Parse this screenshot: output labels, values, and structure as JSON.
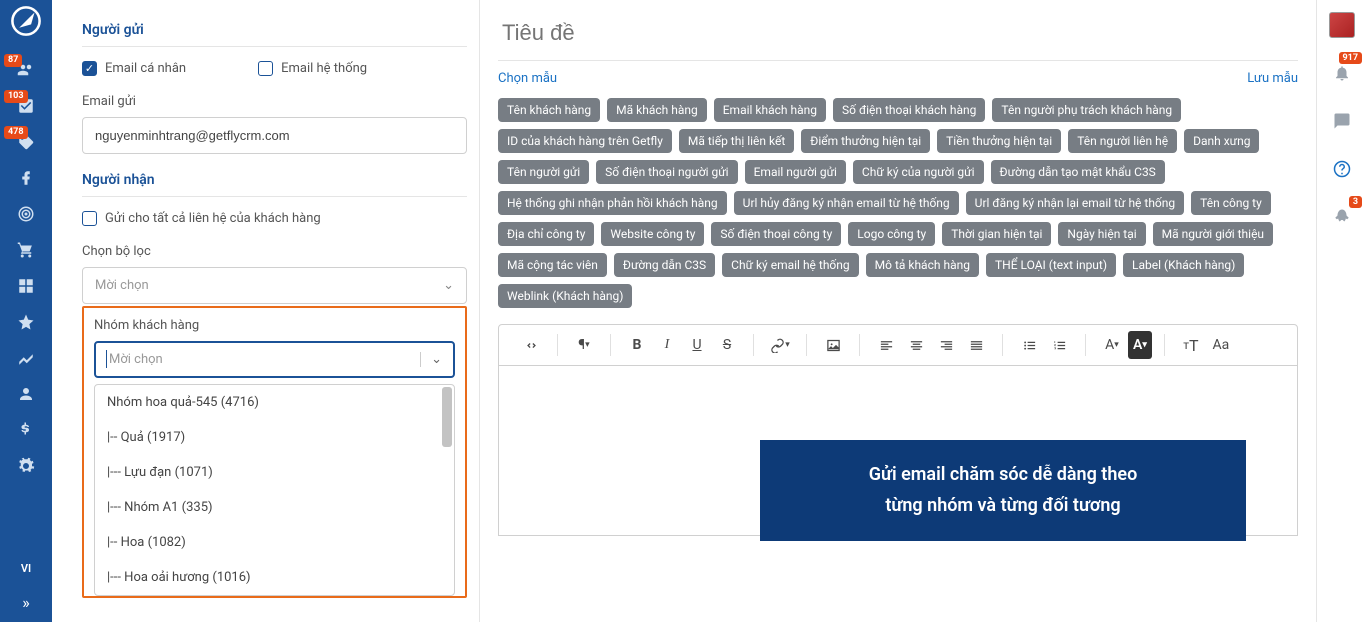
{
  "sidebar_left": {
    "badges": [
      "87",
      "103",
      "478"
    ],
    "vi": "VI",
    "expand": "»"
  },
  "sidebar_right": {
    "notif_badge": "917",
    "rocket_badge": "3"
  },
  "left_panel": {
    "sender_title": "Người gửi",
    "cb_personal": "Email cá nhân",
    "cb_system": "Email hệ thống",
    "email_label": "Email gửi",
    "email_value": "nguyenminhtrang@getflycrm.com",
    "recipient_title": "Người nhận",
    "cb_all_contacts": "Gửi cho tất cả liên hệ của khách hàng",
    "filter_label": "Chọn bộ lọc",
    "filter_placeholder": "Mời chọn",
    "group_label": "Nhóm khách hàng",
    "group_placeholder": "Mời chọn",
    "dropdown": [
      "Nhóm hoa quả-545 (4716)",
      "|-- Quả (1917)",
      "|--- Lựu đạn (1071)",
      "|--- Nhóm A1 (335)",
      "|-- Hoa (1082)",
      "|--- Hoa oải hương (1016)"
    ]
  },
  "main": {
    "title_placeholder": "Tiêu đề",
    "choose_template": "Chọn mẫu",
    "save_template": "Lưu mẫu",
    "tags": [
      "Tên khách hàng",
      "Mã khách hàng",
      "Email khách hàng",
      "Số điện thoại khách hàng",
      "Tên người phụ trách khách hàng",
      "ID của khách hàng trên Getfly",
      "Mã tiếp thị liên kết",
      "Điểm thưởng hiện tại",
      "Tiền thưởng hiện tại",
      "Tên người liên hệ",
      "Danh xưng",
      "Tên người gửi",
      "Số điện thoại người gửi",
      "Email người gửi",
      "Chữ ký của người gửi",
      "Đường dẫn tạo mật khẩu C3S",
      "Hệ thống ghi nhận phản hồi khách hàng",
      "Url hủy đăng ký nhận email từ hệ thống",
      "Url đăng ký nhận lại email từ hệ thống",
      "Tên công ty",
      "Địa chỉ công ty",
      "Website công ty",
      "Số điện thoại công ty",
      "Logo công ty",
      "Thời gian hiện tại",
      "Ngày hiện tại",
      "Mã người giới thiệu",
      "Mã cộng tác viên",
      "Đường dẫn C3S",
      "Chữ ký email hệ thống",
      "Mô tả khách hàng",
      "THỂ LOẠI (text input)",
      "Label (Khách hàng)",
      "Weblink (Khách hàng)"
    ]
  },
  "callout": {
    "line1": "Gửi email chăm sóc dễ dàng theo",
    "line2": "từng nhóm và từng đối tương"
  }
}
